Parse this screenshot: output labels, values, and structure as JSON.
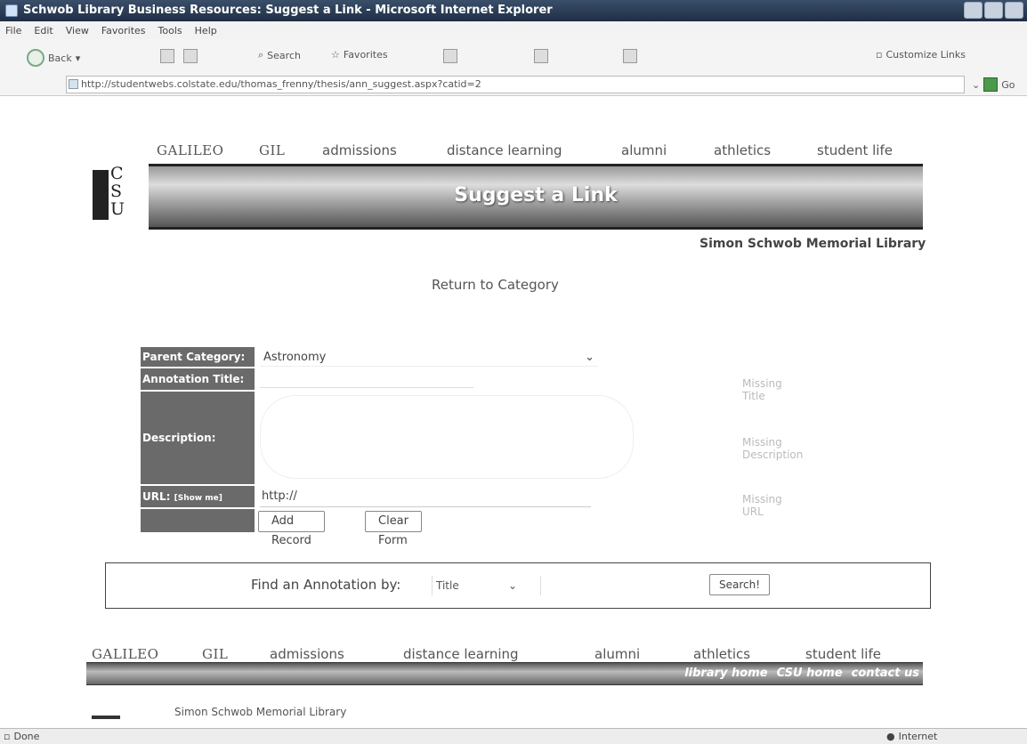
{
  "window": {
    "title": "Schwob Library Business Resources: Suggest a Link - Microsoft Internet Explorer"
  },
  "menubar": {
    "items": [
      "File",
      "Edit",
      "View",
      "Favorites",
      "Tools",
      "Help"
    ]
  },
  "toolbar": {
    "back": "Back",
    "search": "Search",
    "favorites": "Favorites",
    "customize_links": "Customize Links"
  },
  "address": {
    "url": "http://studentwebs.colstate.edu/thomas_frenny/thesis/ann_suggest.aspx?catid=2",
    "go": "Go"
  },
  "nav": {
    "galileo": "GALILEO",
    "gil": "GIL",
    "admissions": "admissions",
    "distance": "distance learning",
    "alumni": "alumni",
    "athletics": "athletics",
    "student_life": "student life"
  },
  "logo": {
    "c": "C",
    "s": "S",
    "u": "U"
  },
  "banner": {
    "title": "Suggest a Link"
  },
  "library_name": "Simon Schwob Memorial Library",
  "return_link": "Return to Category",
  "form": {
    "parent_label": "Parent Category:",
    "parent_value": "Astronomy",
    "title_label": "Annotation Title:",
    "title_msg": "Missing Title",
    "description_label": "Description:",
    "description_msg": "Missing Description",
    "url_label": "URL:",
    "url_show": "[Show me]",
    "url_value": "http://",
    "url_msg": "Missing URL",
    "add_button": "Add Record",
    "clear_button": "Clear Form"
  },
  "find": {
    "label": "Find an Annotation by:",
    "select_value": "Title",
    "search_button": "Search!"
  },
  "footer": {
    "links": [
      "library home",
      "CSU home",
      "contact us"
    ],
    "library": "Simon Schwob Memorial Library"
  },
  "status": {
    "left": "Done",
    "right": "Internet"
  }
}
